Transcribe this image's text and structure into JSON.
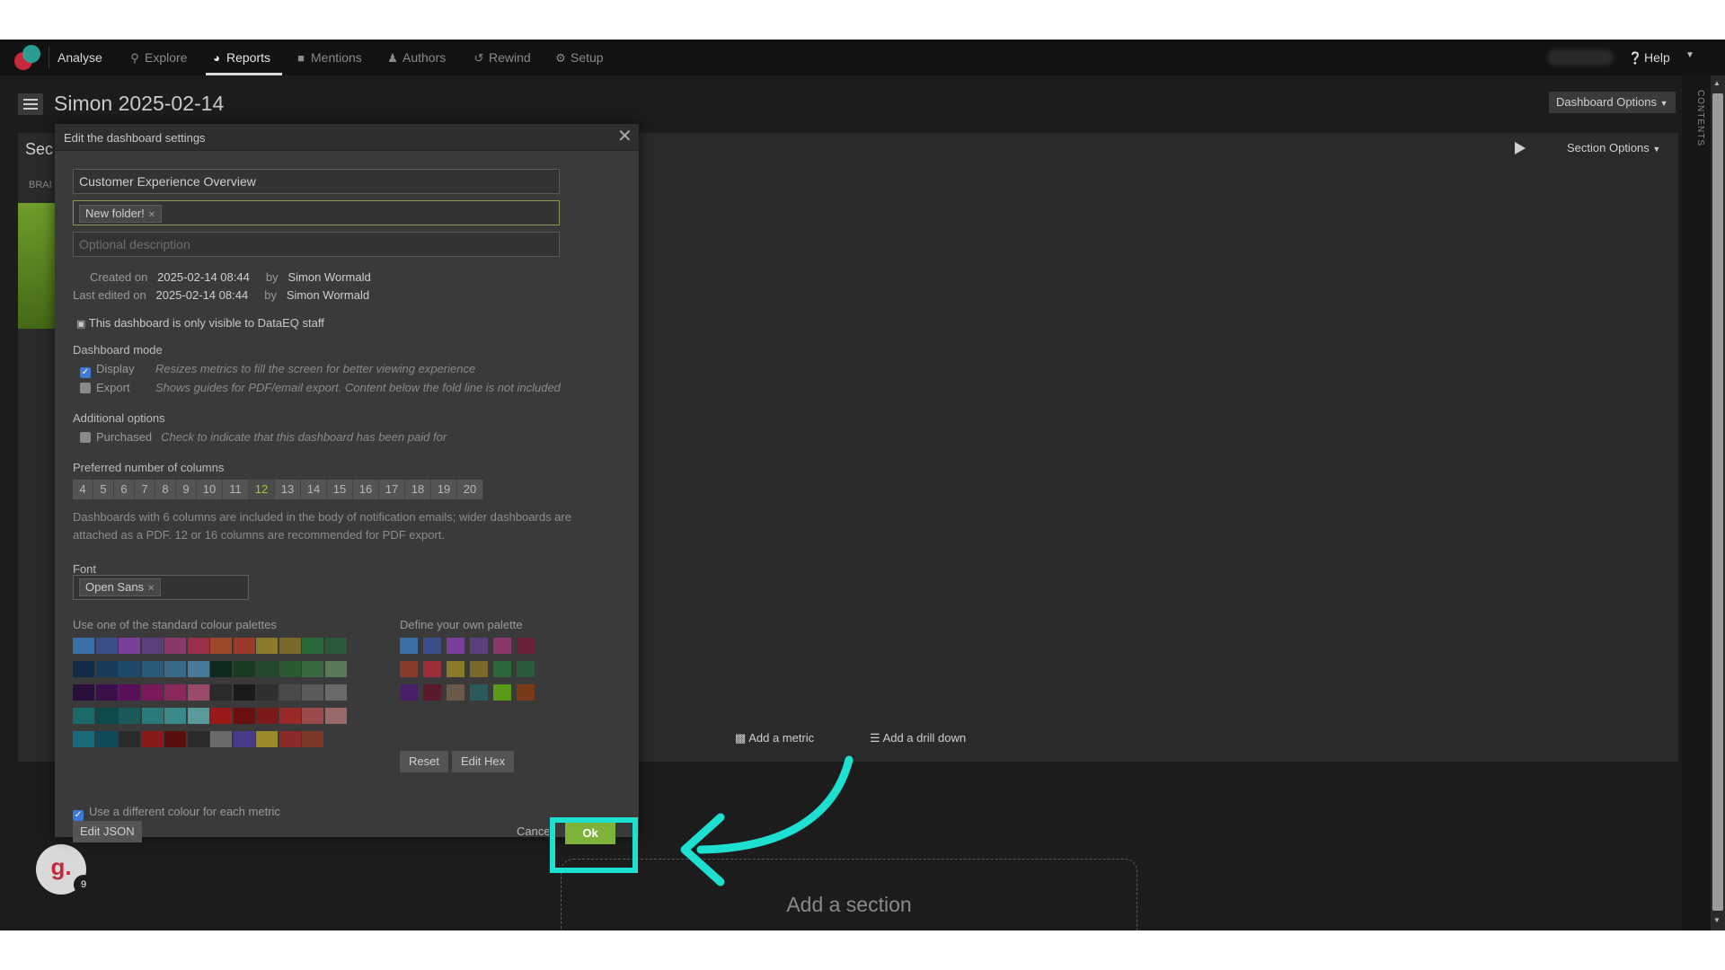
{
  "nav": {
    "analyse": "Analyse",
    "items": [
      {
        "label": "Explore",
        "icon": "search-icon"
      },
      {
        "label": "Reports",
        "icon": "pie-chart-icon"
      },
      {
        "label": "Mentions",
        "icon": "speech-bubble-icon"
      },
      {
        "label": "Authors",
        "icon": "user-icon"
      },
      {
        "label": "Rewind",
        "icon": "history-icon"
      },
      {
        "label": "Setup",
        "icon": "gear-icon"
      }
    ],
    "active": "Reports",
    "help": "Help"
  },
  "right_rail": {
    "label": "CONTENTS"
  },
  "header": {
    "title": "Simon 2025-02-14",
    "dashboard_options": "Dashboard Options"
  },
  "section": {
    "title": "Sec",
    "brand_label": "BRAI",
    "options": "Section Options",
    "add_metric": "Add a metric",
    "add_drill_down": "Add a drill down",
    "add_section": "Add a section"
  },
  "avatar": {
    "letter": "g.",
    "badge": "9"
  },
  "modal": {
    "title": "Edit the dashboard settings",
    "name_value": "Customer Experience Overview",
    "folder_tag": "New folder!",
    "description_placeholder": "Optional description",
    "created_label": "Created on",
    "created_date": "2025-02-14 08:44",
    "created_by_label": "by",
    "created_by": "Simon Wormald",
    "edited_label": "Last edited on",
    "edited_date": "2025-02-14 08:44",
    "edited_by_label": "by",
    "edited_by": "Simon Wormald",
    "visibility_note": "This dashboard is only visible to DataEQ staff",
    "dashboard_mode_label": "Dashboard mode",
    "modes": [
      {
        "label": "Display",
        "desc": "Resizes metrics to fill the screen for better viewing experience",
        "checked": true
      },
      {
        "label": "Export",
        "desc": "Shows guides for PDF/email export. Content below the fold line is not included",
        "checked": false
      }
    ],
    "additional_label": "Additional options",
    "purchased_label": "Purchased",
    "purchased_desc": "Check to indicate that this dashboard has been paid for",
    "columns_label": "Preferred number of columns",
    "columns": [
      "4",
      "5",
      "6",
      "7",
      "8",
      "9",
      "10",
      "11",
      "12",
      "13",
      "14",
      "15",
      "16",
      "17",
      "18",
      "19",
      "20"
    ],
    "columns_selected": "12",
    "columns_note": "Dashboards with 6 columns are included in the body of notification emails; wider dashboards are attached as a PDF. 12 or 16 columns are recommended for PDF export.",
    "font_label": "Font",
    "font_tag": "Open Sans",
    "standard_palettes_label": "Use one of the standard colour palettes",
    "own_palette_label": "Define your own palette",
    "standard_palettes": [
      [
        "#3a6fa8",
        "#3a4f88",
        "#7a3f9a",
        "#5a3f7a",
        "#8a3a6a",
        "#9a2f4a",
        "#9a4a2a",
        "#9a3a2a",
        "#8a7a2a",
        "#7a6a2a",
        "#2a6a3a",
        "#2a5a3a"
      ],
      [
        "#122a4a",
        "#1a3a5a",
        "#1f4a6a",
        "#2a5a7a",
        "#3a6a8a",
        "#4a7a9a",
        "#0f2a1a",
        "#1a3a22",
        "#224a2a",
        "#2a5a32",
        "#3a6a42",
        "#5a7a5a"
      ],
      [
        "#2a0f3a",
        "#3a0f4a",
        "#5a0f5a",
        "#7a1a5a",
        "#8a2a5a",
        "#9a4a6a",
        "#2a2a2a",
        "#1a1a1a",
        "#2f2f2f",
        "#4a4a4a",
        "#5a5a5a",
        "#6a6a6a"
      ],
      [
        "#1a6a6a",
        "#0f4a4a",
        "#1a5a5a",
        "#2a7a7a",
        "#3a8a8a",
        "#5a9a9a",
        "#9a1a1a",
        "#6a0f0f",
        "#7a1a1a",
        "#9a2a2a",
        "#9a4a4a",
        "#9a6a6a"
      ],
      [
        "#1a6a7a",
        "#0f4a5a",
        "#2a2a2a",
        "#8a1a1a",
        "#5a0f0f",
        "#2a2a2a",
        "#6a6a6a",
        "#4a3a8a",
        "#9a8a2a",
        "#8a2a2a",
        "#7a3a2a"
      ]
    ],
    "own_palette": [
      [
        "#3a6fa8",
        "#3a4f88",
        "#7a3f9a",
        "#5a3f7a",
        "#8a3a6a",
        "#6a1f3a"
      ],
      [
        "#8a3a2a",
        "#9a2f3a",
        "#8a7a2a",
        "#7a6a2a",
        "#2a6a3a",
        "#2a5a3a"
      ],
      [
        "#4a1f6a",
        "#5a1a2a",
        "#6a5a4a",
        "#2a5a5a",
        "#5a9a1a",
        "#7a3a1a"
      ]
    ],
    "reset": "Reset",
    "edit_hex": "Edit Hex",
    "different_colour_label": "Use a different colour for each metric",
    "edit_json": "Edit JSON",
    "cancel": "Cancel",
    "ok": "Ok"
  },
  "colors": {
    "accent_green": "#7fb23a",
    "highlight": "#1ee0d0",
    "background": "#1c1c1c"
  }
}
